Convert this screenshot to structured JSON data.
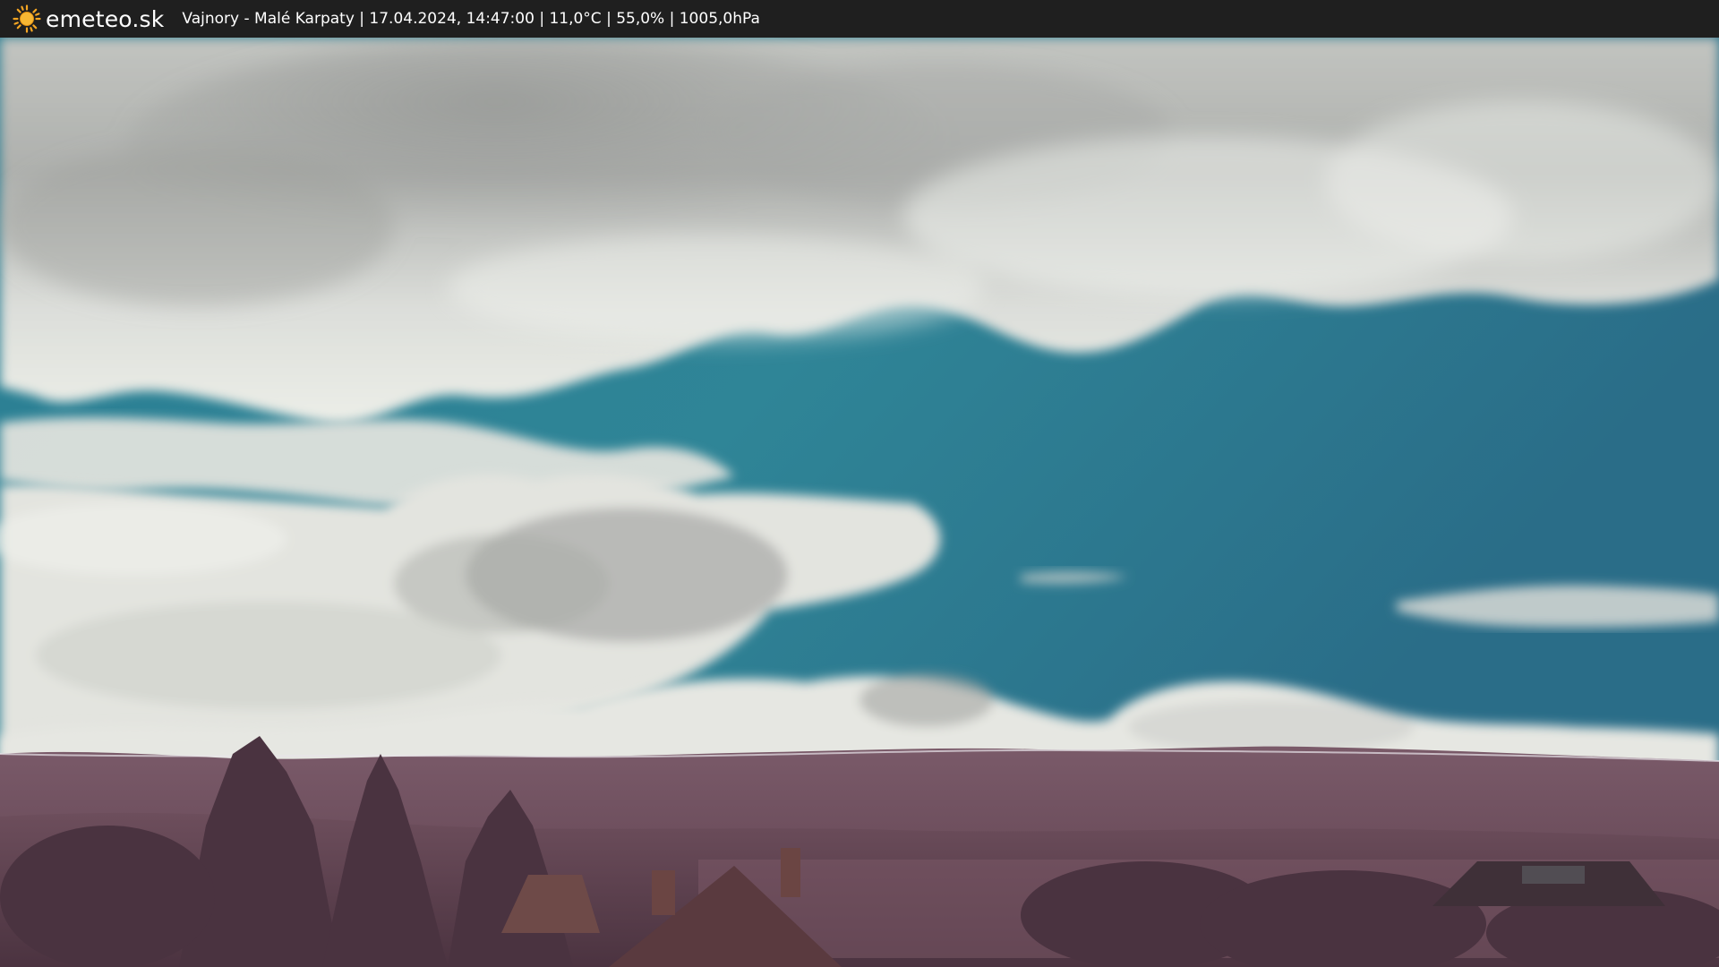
{
  "header": {
    "brand": "emeteo.sk",
    "station_info": "Vajnory - Malé Karpaty | 17.04.2024, 14:47:00 | 11,0°C | 55,0% | 1005,0hPa",
    "logo_icon": "sun-icon"
  },
  "colors": {
    "bar_background": "#1f1f1f",
    "sun": "#f5a623",
    "sky": "#2f7f93",
    "cloud": "#e4e6e1",
    "hills": "#6e4f5e",
    "foreground": "#5e3f4c"
  }
}
